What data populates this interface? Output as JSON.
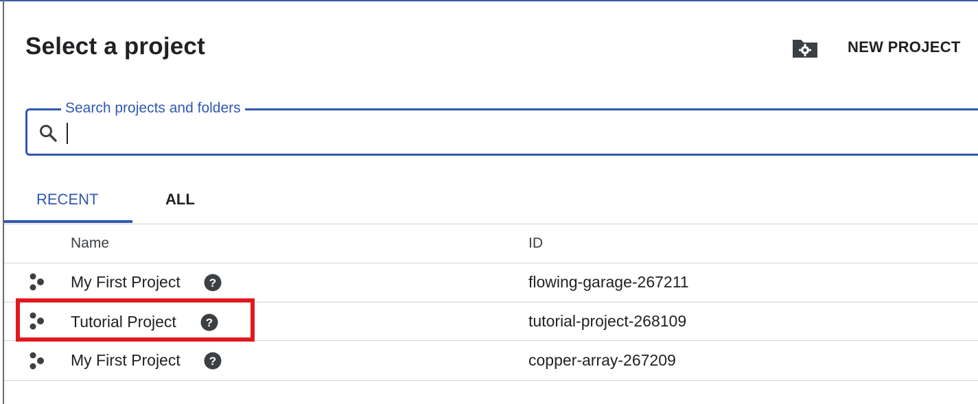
{
  "dialog": {
    "title": "Select a project"
  },
  "toolbar": {
    "new_project_label": "NEW PROJECT",
    "new_project_icon": "folder-settings-icon"
  },
  "search": {
    "legend": "Search projects and folders",
    "value": "",
    "placeholder": ""
  },
  "tabs": [
    {
      "label": "RECENT",
      "active": true
    },
    {
      "label": "ALL",
      "active": false
    }
  ],
  "table": {
    "columns": {
      "name": "Name",
      "id": "ID"
    },
    "rows": [
      {
        "name": "My First Project",
        "id": "flowing-garage-267211"
      },
      {
        "name": "Tutorial Project",
        "id": "tutorial-project-268109",
        "highlighted": true
      },
      {
        "name": "My First Project",
        "id": "copper-array-267209"
      }
    ]
  },
  "colors": {
    "accent": "#2f58b0",
    "highlight": "#e0191d",
    "text": "#202124"
  }
}
